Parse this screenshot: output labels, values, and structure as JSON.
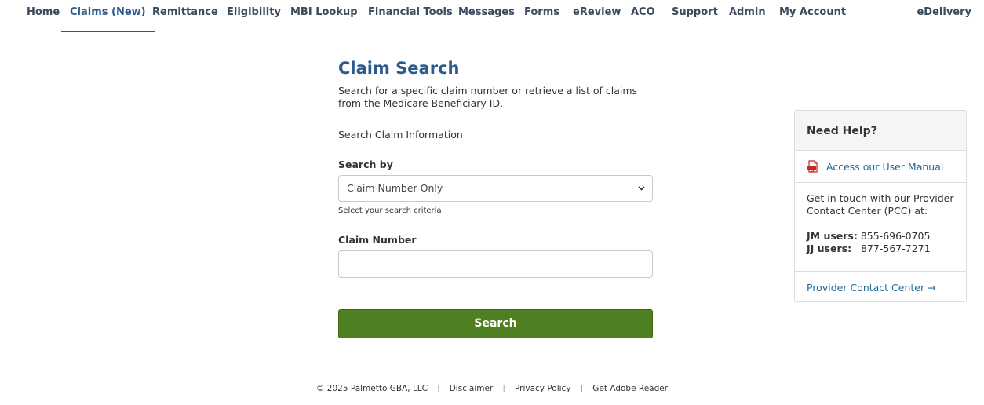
{
  "nav": {
    "items": [
      {
        "label": "Home"
      },
      {
        "label": "Claims (New)"
      },
      {
        "label": "Remittance"
      },
      {
        "label": "Eligibility"
      },
      {
        "label": "MBI Lookup"
      },
      {
        "label": "Financial Tools"
      },
      {
        "label": "Messages"
      },
      {
        "label": "Forms"
      },
      {
        "label": "eReview"
      },
      {
        "label": "ACO"
      },
      {
        "label": "Support"
      },
      {
        "label": "Admin"
      },
      {
        "label": "My Account"
      }
    ],
    "active": "Claims (New)",
    "right_label": "eDelivery"
  },
  "main": {
    "title": "Claim Search",
    "description": "Search for a specific claim number or retrieve a list of claims from the Medicare Beneficiary ID.",
    "section_label": "Search Claim Information",
    "search_by_label": "Search by",
    "search_by_selected": "Claim Number Only",
    "search_by_help": "Select your search criteria",
    "claim_number_label": "Claim Number",
    "claim_number_value": "",
    "search_button": "Search"
  },
  "help": {
    "title": "Need Help?",
    "manual_link": "Access our User Manual",
    "contact_text": "Get in touch with our Provider Contact Center (PCC) at:",
    "jm_label": "JM users:",
    "jm_phone": "855-696-0705",
    "jj_label": "JJ users:",
    "jj_phone": "877-567-7271",
    "pcc_link": "Provider Contact Center →"
  },
  "footer": {
    "copyright": "© 2025 Palmetto GBA, LLC",
    "links": [
      "Disclaimer",
      "Privacy Policy",
      "Get Adobe Reader"
    ]
  },
  "colors": {
    "accent": "#2d5a8c",
    "button_green": "#4e7f20",
    "link": "#1f6a9a"
  },
  "icons": {
    "manual": "pdf-icon",
    "select": "chevron-down-icon"
  }
}
